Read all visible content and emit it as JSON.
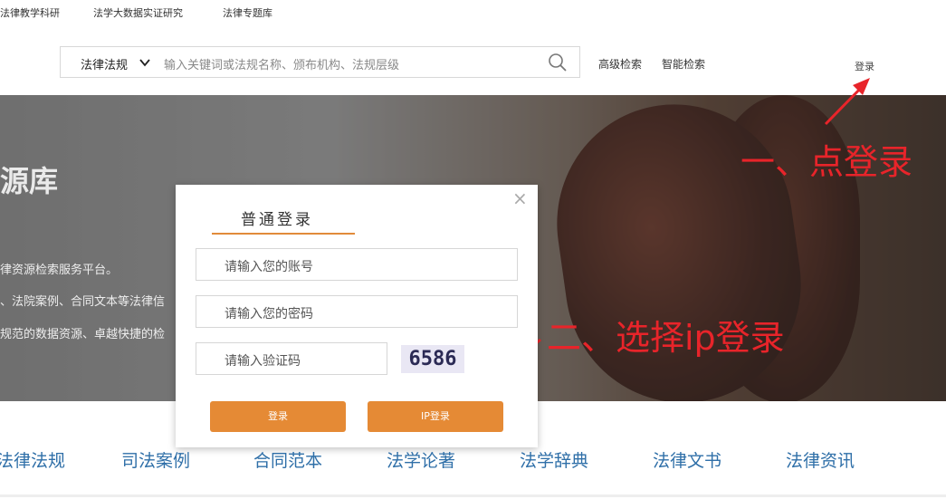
{
  "topnav": {
    "items": [
      "法律教学科研",
      "法学大数据实证研究",
      "法律专题库"
    ]
  },
  "search": {
    "category": "法律法规",
    "placeholder": "输入关键词或法规名称、颁布机构、法规层级",
    "advanced": "高级检索",
    "smart": "智能检索"
  },
  "header": {
    "login": "登录"
  },
  "banner": {
    "title": "源库",
    "lines": [
      "律资源检索服务平台。",
      "、法院案例、合同文本等法律信",
      "规范的数据资源、卓越快捷的检"
    ]
  },
  "annotations": {
    "step1": "一、点登录",
    "step2": "二、选择ip登录",
    "color": "#e8242a"
  },
  "modal": {
    "close": "×",
    "tab": "普通登录",
    "account_placeholder": "请输入您的账号",
    "password_placeholder": "请输入您的密码",
    "captcha_placeholder": "请输入验证码",
    "captcha_code": "6586",
    "login_button": "登录",
    "ip_login_button": "IP登录",
    "accent": "#e58a35"
  },
  "bottomnav": {
    "items": [
      "法律法规",
      "司法案例",
      "合同范本",
      "法学论著",
      "法学辞典",
      "法律文书",
      "法律资讯"
    ]
  }
}
